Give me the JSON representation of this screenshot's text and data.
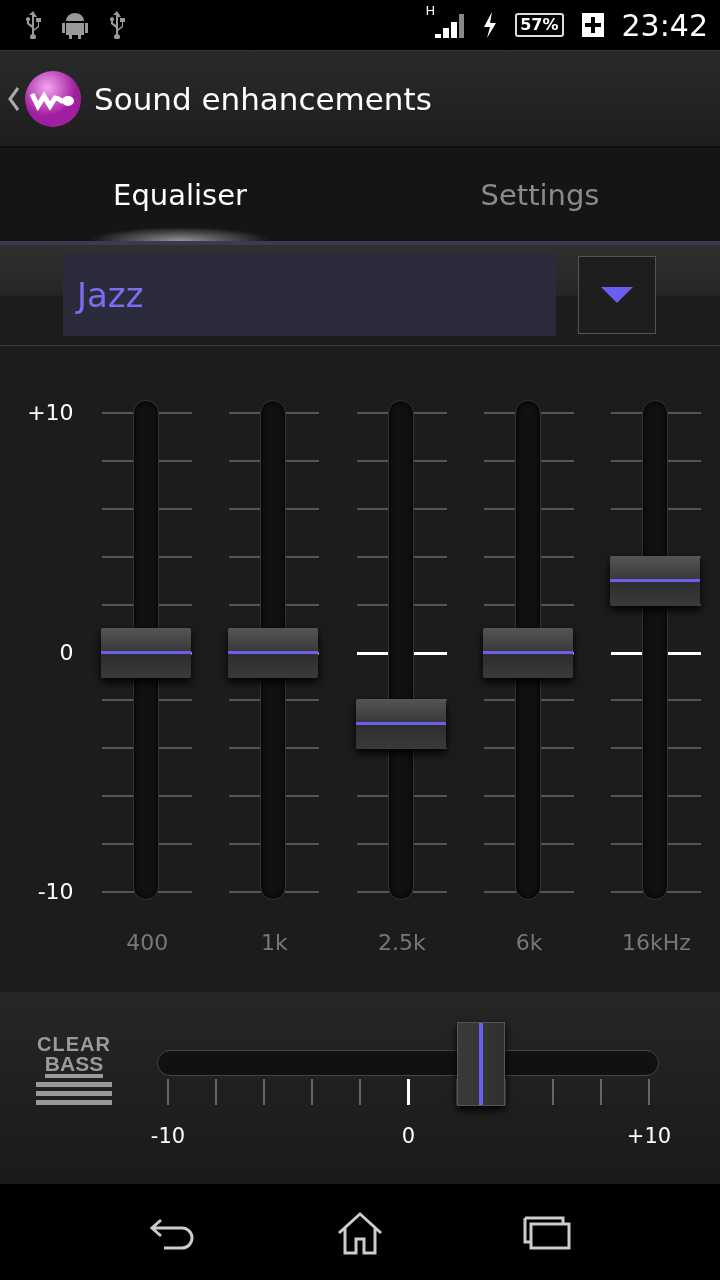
{
  "status_bar": {
    "network": "H",
    "battery": "57%",
    "time": "23:42"
  },
  "action_bar": {
    "title": "Sound enhancements"
  },
  "tabs": [
    {
      "label": "Equaliser",
      "selected": true
    },
    {
      "label": "Settings",
      "selected": false
    }
  ],
  "preset": {
    "value": "Jazz"
  },
  "equaliser": {
    "scale": [
      "+10",
      "0",
      "-10"
    ],
    "bands": [
      {
        "label": "400",
        "level": 0.5
      },
      {
        "label": "1k",
        "level": 0.5
      },
      {
        "label": "2.5k",
        "level": 0.35
      },
      {
        "label": "6k",
        "level": 0.5
      },
      {
        "label": "16kHz",
        "level": 0.65
      }
    ]
  },
  "clear_bass": {
    "logo_top": "CLEAR",
    "logo_bottom": "BASS",
    "level": 0.65,
    "scale": [
      "-10",
      "0",
      "+10"
    ]
  }
}
